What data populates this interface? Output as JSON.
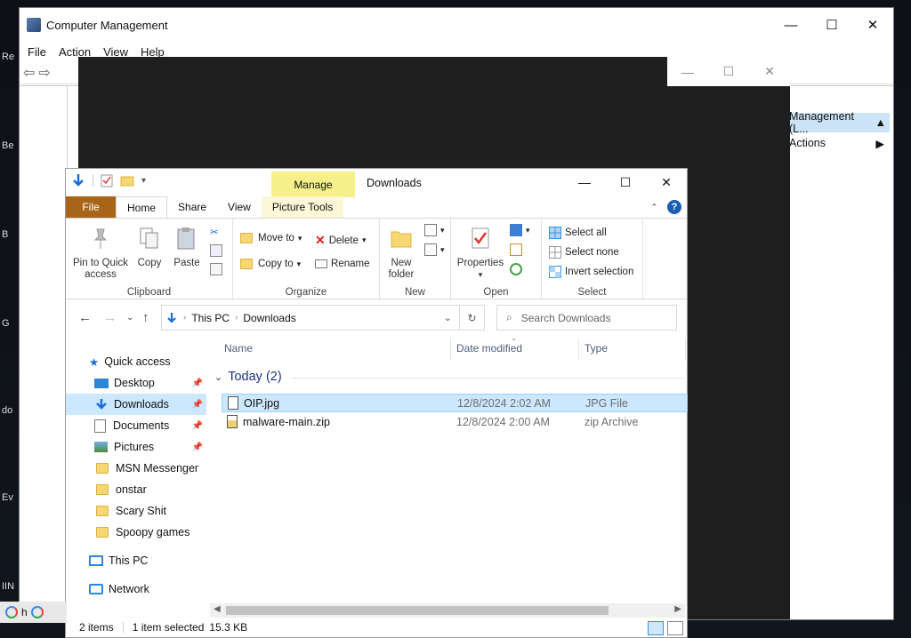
{
  "desktop": {
    "icon_labels": [
      "Re",
      "Be",
      "B",
      "G",
      "do",
      "Ev",
      "IIN"
    ]
  },
  "computer_management": {
    "title": "Computer Management",
    "menu": [
      "File",
      "Action",
      "View",
      "Help"
    ],
    "actions": {
      "header": "Management (L...",
      "row": "Actions"
    }
  },
  "explorer": {
    "title": "Downloads",
    "manage_tab": "Manage",
    "tabs": [
      "File",
      "Home",
      "Share",
      "View",
      "Picture Tools"
    ],
    "ribbon": {
      "clipboard": {
        "pin": "Pin to Quick access",
        "copy": "Copy",
        "paste": "Paste",
        "label": "Clipboard"
      },
      "organize": {
        "move_to": "Move to",
        "copy_to": "Copy to",
        "delete": "Delete",
        "rename": "Rename",
        "label": "Organize"
      },
      "new": {
        "new_folder": "New folder",
        "label": "New"
      },
      "open": {
        "properties": "Properties",
        "label": "Open"
      },
      "select": {
        "select_all": "Select all",
        "select_none": "Select none",
        "invert": "Invert selection",
        "label": "Select"
      }
    },
    "address": {
      "crumbs": [
        "This PC",
        "Downloads"
      ],
      "search_placeholder": "Search Downloads"
    },
    "nav": {
      "quick_access": "Quick access",
      "items": [
        "Desktop",
        "Downloads",
        "Documents",
        "Pictures",
        "MSN Messenger",
        "onstar",
        "Scary Shit",
        "Spoopy games"
      ],
      "this_pc": "This PC",
      "network": "Network"
    },
    "columns": {
      "name": "Name",
      "date": "Date modified",
      "type": "Type"
    },
    "group": "Today (2)",
    "files": [
      {
        "name": "OIP.jpg",
        "date": "12/8/2024 2:02 AM",
        "type": "JPG File",
        "selected": true
      },
      {
        "name": "malware-main.zip",
        "date": "12/8/2024 2:00 AM",
        "type": "zip Archive",
        "selected": false
      }
    ],
    "status": {
      "items": "2 items",
      "selected": "1 item selected",
      "size": "15.3 KB"
    }
  },
  "taskbar": {
    "text": "h"
  },
  "colors": {
    "file_tab": "#a8651a",
    "manage_tab": "#f5f08a",
    "selection": "#cce8ff",
    "group_header": "#1e3287"
  }
}
